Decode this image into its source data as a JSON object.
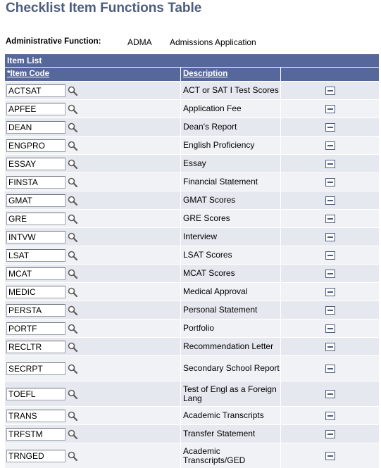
{
  "page": {
    "title": "Checklist Item Functions Table"
  },
  "admin_function": {
    "label": "Administrative Function:",
    "code": "ADMA",
    "description": "Admissions Application"
  },
  "grid": {
    "title": "Item List",
    "columns": {
      "item_code": "*Item Code",
      "description": "Description"
    },
    "rows": [
      {
        "code": "ACTSAT",
        "description": "ACT or SAT I Test Scores"
      },
      {
        "code": "APFEE",
        "description": "Application Fee"
      },
      {
        "code": "DEAN",
        "description": "Dean's Report"
      },
      {
        "code": "ENGPRO",
        "description": "English Proficiency"
      },
      {
        "code": "ESSAY",
        "description": "Essay"
      },
      {
        "code": "FINSTA",
        "description": "Financial Statement"
      },
      {
        "code": "GMAT",
        "description": "GMAT Scores"
      },
      {
        "code": "GRE",
        "description": "GRE Scores"
      },
      {
        "code": "INTVW",
        "description": "Interview"
      },
      {
        "code": "LSAT",
        "description": "LSAT Scores"
      },
      {
        "code": "MCAT",
        "description": "MCAT Scores"
      },
      {
        "code": "MEDIC",
        "description": "Medical Approval"
      },
      {
        "code": "PERSTA",
        "description": "Personal Statement"
      },
      {
        "code": "PORTF",
        "description": "Portfolio"
      },
      {
        "code": "RECLTR",
        "description": "Recommendation Letter"
      },
      {
        "code": "SECRPT",
        "description": "Secondary School Report"
      },
      {
        "code": "TOEFL",
        "description": "Test of Engl as a Foreign Lang"
      },
      {
        "code": "TRANS",
        "description": "Academic Transcripts"
      },
      {
        "code": "TRFSTM",
        "description": "Transfer Statement"
      },
      {
        "code": "TRNGED",
        "description": "Academic Transcripts/GED"
      }
    ]
  },
  "icons": {
    "lookup": "magnifier-lookup-icon",
    "delete_row": "minus-delete-row-icon"
  },
  "colors": {
    "title": "#4c5d7e",
    "grid_header": "#56679a",
    "row_odd": "#e6e8ef",
    "row_even": "#f1f2f6"
  }
}
